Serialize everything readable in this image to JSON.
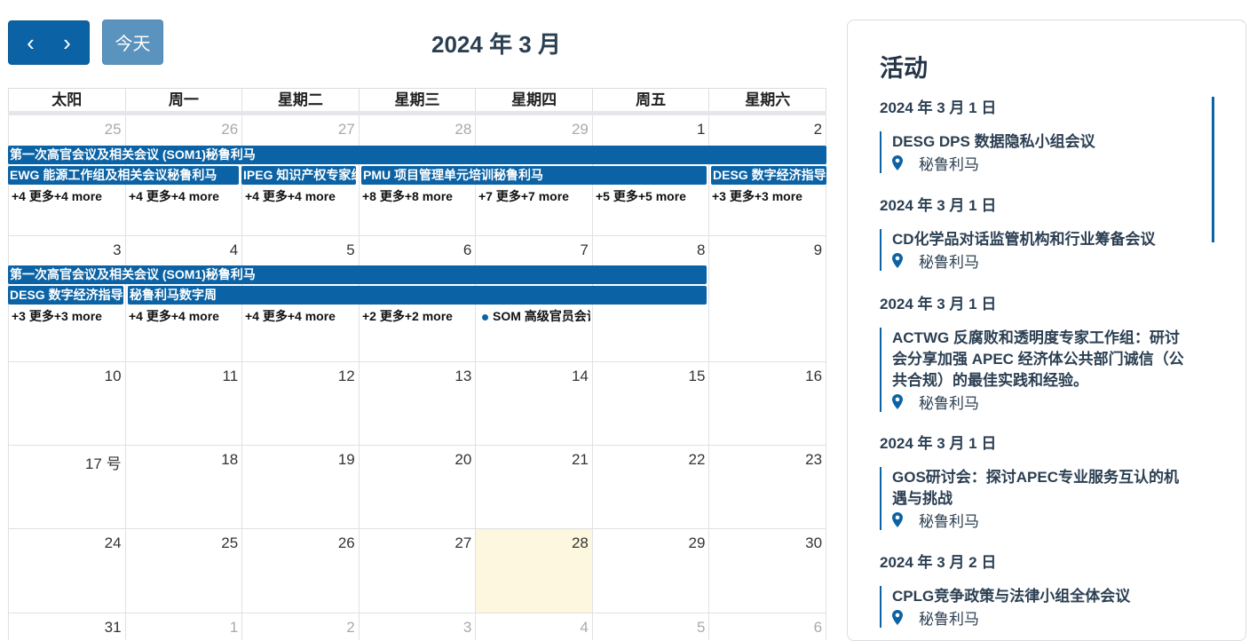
{
  "toolbar": {
    "prev_icon": "‹",
    "next_icon": "›",
    "today_label": "今天",
    "title": "2024 年 3 月"
  },
  "weekdays": [
    "太阳",
    "周一",
    "星期二",
    "星期三",
    "星期四",
    "周五",
    "星期六"
  ],
  "weeks": [
    {
      "days": [
        "25",
        "26",
        "27",
        "28",
        "29",
        "1",
        "2"
      ]
    },
    {
      "days": [
        "3",
        "4",
        "5",
        "6",
        "7",
        "8",
        "9"
      ]
    },
    {
      "days": [
        "10",
        "11",
        "12",
        "13",
        "14",
        "15",
        "16"
      ]
    },
    {
      "days": [
        "17 号",
        "18",
        "19",
        "20",
        "21",
        "22",
        "23"
      ]
    },
    {
      "days": [
        "24",
        "25",
        "26",
        "27",
        "28",
        "29",
        "30"
      ]
    },
    {
      "days": [
        "31",
        "1",
        "2",
        "3",
        "4",
        "5",
        "6"
      ]
    }
  ],
  "events": {
    "w1_som1": "第一次高官会议及相关会议 (SOM1)秘鲁利马",
    "w1_ewg": "EWG 能源工作组及相关会议秘鲁利马",
    "w1_ipeg": "IPEG 知识产权专家组会议",
    "w1_pmu": "PMU 项目管理单元培训秘鲁利马",
    "w1_desg": "DESG 数字经济指导组会议",
    "w2_som1": "第一次高官会议及相关会议 (SOM1)秘鲁利马",
    "w2_desg": "DESG 数字经济指导组会议",
    "w2_digital_week": "秘鲁利马数字周",
    "w2_som_dot": "SOM 高级官员会议"
  },
  "more_links": {
    "w1": [
      "+4 更多+4 more",
      "+4 更多+4 more",
      "+4 更多+4 more",
      "+8 更多+8 more",
      "+7 更多+7 more",
      "+5 更多+5 more",
      "+3 更多+3 more"
    ],
    "w2": [
      "+3 更多+3 more",
      "+4 更多+4 more",
      "+4 更多+4 more",
      "+2 更多+2 more"
    ]
  },
  "sidebar": {
    "title": "活动",
    "groups": [
      {
        "date": "2024 年 3 月 1 日",
        "title": "DESG DPS 数据隐私小组会议",
        "location": "秘鲁利马"
      },
      {
        "date": "2024 年 3 月 1 日",
        "title": "CD化学品对话监管机构和行业筹备会议",
        "location": "秘鲁利马"
      },
      {
        "date": "2024 年 3 月 1 日",
        "title": "ACTWG 反腐败和透明度专家工作组：研讨会分享加强 APEC 经济体公共部门诚信（公共合规）的最佳实践和经验。",
        "location": "秘鲁利马"
      },
      {
        "date": "2024 年 3 月 1 日",
        "title": "GOS研讨会：探讨APEC专业服务互认的机遇与挑战",
        "location": "秘鲁利马"
      },
      {
        "date": "2024 年 3 月 2 日",
        "title": "CPLG竞争政策与法律小组全体会议",
        "location": "秘鲁利马"
      }
    ]
  },
  "colors": {
    "accent": "#0b63a5",
    "today_bg": "#fdf7df",
    "today_button": "#5b93bf"
  }
}
